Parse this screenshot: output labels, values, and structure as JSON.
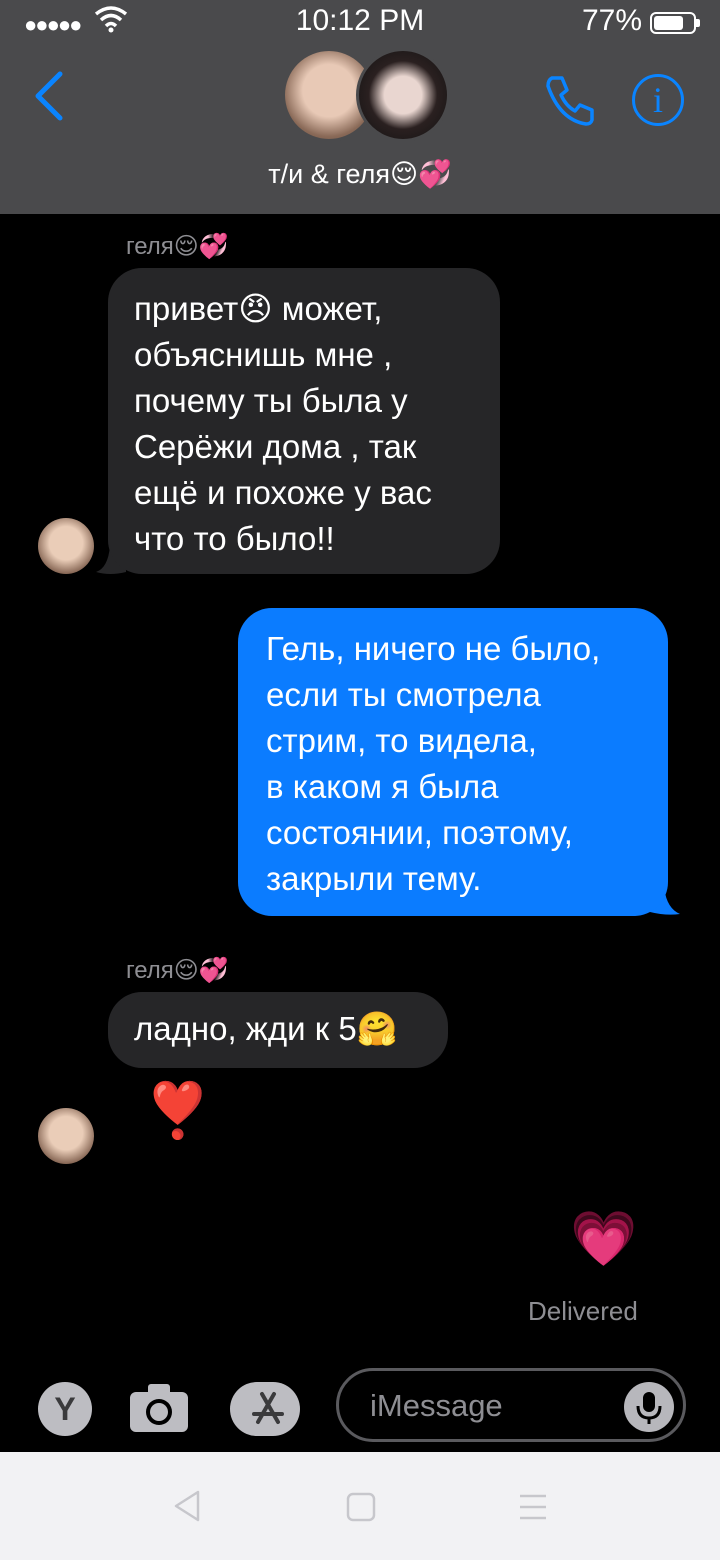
{
  "status_bar": {
    "signal": "●●●●●",
    "time": "10:12 PM",
    "battery_pct": "77%",
    "battery_level": 0.77
  },
  "header": {
    "title": "т/и & геля😌💞"
  },
  "messages": [
    {
      "sender": "геля😌💞",
      "text_lines": [
        "привет😠 может,",
        "объяснишь мне ,",
        "почему ты была у",
        "Серёжи дома , так",
        "ещё и похоже у вас",
        "что то было!!"
      ]
    },
    {
      "text_lines": [
        "Гель, ничего не было,",
        "если ты смотрела",
        "стрим, то видела,",
        "в каком я была",
        "состоянии, поэтому,",
        "закрыли тему."
      ]
    },
    {
      "sender": "геля😌💞",
      "text": "ладно, жди к 5🤗"
    },
    {
      "emoji": "❣️"
    },
    {
      "emoji": "💗"
    }
  ],
  "delivered": "Delivered",
  "input": {
    "placeholder": "iMessage",
    "app_button": "Y"
  },
  "icons": [
    "back-chevron-icon",
    "phone-icon",
    "info-icon",
    "camera-icon",
    "app-store-icon",
    "mic-icon",
    "nav-back-icon",
    "nav-home-icon",
    "nav-menu-icon"
  ],
  "colors": {
    "accent": "#0a84ff",
    "outgoing_bubble": "#0b7cff",
    "incoming_bubble": "#262628",
    "header_bg": "#4a4a4c"
  }
}
